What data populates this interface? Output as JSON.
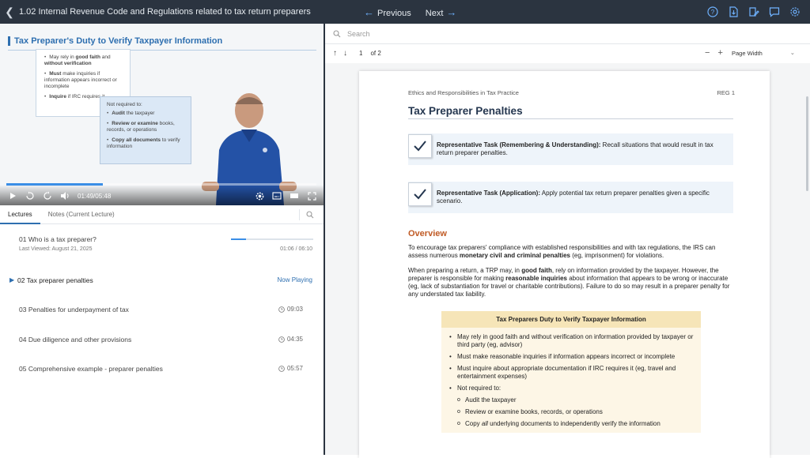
{
  "topbar": {
    "title": "1.02 Internal Revenue Code and Regulations related to tax return preparers",
    "previous": "Previous",
    "next": "Next",
    "tools": [
      "help-icon",
      "document-download-icon",
      "edit-note-icon",
      "comment-icon",
      "gear-icon"
    ]
  },
  "video": {
    "slide_title": "Tax Preparer's Duty to Verify Taxpayer Information",
    "card1": [
      {
        "pre": "May rely in ",
        "bold": "good faith",
        "post": " and",
        "bold2": "without verification"
      },
      {
        "bold": "Must",
        "post": " make inquiries if information appears incorrect or incomplete"
      },
      {
        "bold": "Inquire",
        "post": " if IRC requires it"
      }
    ],
    "card2_head": "Not required to:",
    "card2": [
      {
        "bold": "Audit",
        "post": " the taxpayer"
      },
      {
        "bold": "Review or examine",
        "post": " books, records, or operations"
      },
      {
        "bold": "Copy all documents",
        "post": " to verify information"
      }
    ],
    "time": "01:49/05:48",
    "progress_fraction": 0.31
  },
  "tabs": {
    "lectures": "Lectures",
    "notes": "Notes (Current Lecture)"
  },
  "lectures": [
    {
      "name": "01 Who is a tax preparer?",
      "sub": "Last Viewed: August 21, 2025",
      "time": "01:06 / 06:10",
      "progress": 0.18
    },
    {
      "name": "02 Tax preparer penalties",
      "status": "Now Playing"
    },
    {
      "name": "03 Penalties for underpayment of tax",
      "dur": "09:03"
    },
    {
      "name": "04 Due diligence and other provisions",
      "dur": "04:35"
    },
    {
      "name": "05 Comprehensive example - preparer penalties",
      "dur": "05:57"
    }
  ],
  "pdf": {
    "search_placeholder": "Search",
    "page": "1",
    "of_pages": "of 2",
    "zoom": "Page Width",
    "header_left": "Ethics and Responsibilities in Tax Practice",
    "header_right": "REG 1",
    "title": "Tax Preparer Penalties",
    "task1_label": "Representative Task (Remembering & Understanding):",
    "task1_text": " Recall situations that would result in tax return preparer penalties.",
    "task2_label": "Representative Task (Application):",
    "task2_text": " Apply potential tax return preparer penalties given a specific scenario.",
    "overview": "Overview",
    "para1_a": "To encourage tax preparers' compliance with established responsibilities and with tax regulations, the IRS can assess numerous ",
    "para1_b": "monetary civil and criminal penalties",
    "para1_c": " (eg, imprisonment) for violations.",
    "para2_a": "When preparing a return, a TRP may, in ",
    "para2_b": "good faith",
    "para2_c": ", rely on information provided by the taxpayer. However, the preparer is responsible for making ",
    "para2_d": "reasonable inquiries",
    "para2_e": " about information that appears to be wrong or inaccurate (eg, lack of substantiation for travel or charitable contributions). Failure to do so may result in a preparer penalty for any understated tax liability.",
    "box_title": "Tax Preparers Duty to Verify Taxpayer Information",
    "box_items": [
      "May rely in good faith and without verification on information provided by taxpayer or third party (eg, advisor)",
      "Must make reasonable inquiries if information appears incorrect or incomplete",
      "Must inquire about appropriate documentation if IRC requires it (eg, travel and entertainment expenses)",
      "Not required to:"
    ],
    "box_sub_items": [
      "Audit the taxpayer",
      "Review or examine books, records, or operations"
    ],
    "box_last_a": "Copy ",
    "box_last_b": "all",
    "box_last_c": " underlying documents to independently verify the information"
  }
}
